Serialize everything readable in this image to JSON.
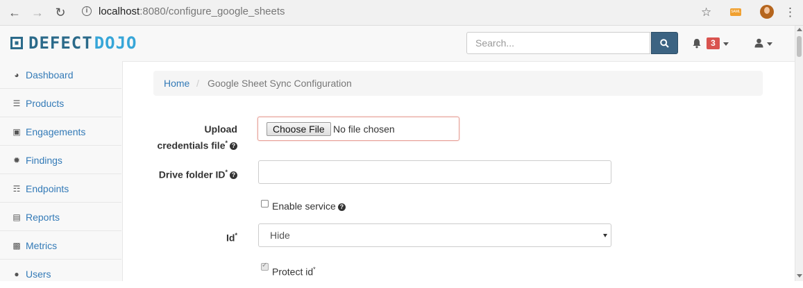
{
  "browser": {
    "host": "localhost",
    "path": ":8080/configure_google_sheets"
  },
  "header": {
    "logo_part1": "DEFECT",
    "logo_part2": "DOJO",
    "search_placeholder": "Search...",
    "notification_count": "3"
  },
  "sidebar": {
    "items": [
      {
        "label": "Dashboard",
        "icon": "dashboard-icon"
      },
      {
        "label": "Products",
        "icon": "list-icon"
      },
      {
        "label": "Engagements",
        "icon": "inbox-icon"
      },
      {
        "label": "Findings",
        "icon": "bug-icon"
      },
      {
        "label": "Endpoints",
        "icon": "sitemap-icon"
      },
      {
        "label": "Reports",
        "icon": "file-icon"
      },
      {
        "label": "Metrics",
        "icon": "bar-chart-icon"
      },
      {
        "label": "Users",
        "icon": "user-icon"
      }
    ]
  },
  "breadcrumb": {
    "home": "Home",
    "separator": "/",
    "current": "Google Sheet Sync Configuration"
  },
  "form": {
    "upload_label_line1": "Upload",
    "upload_label_line2": "credentials file",
    "choose_file_button": "Choose File",
    "no_file_text": "No file chosen",
    "drive_folder_label": "Drive folder ID",
    "drive_folder_value": "",
    "enable_service_label": "Enable service",
    "enable_service_checked": false,
    "id_label": "Id",
    "id_select_value": "Hide",
    "protect_id_label": "Protect id",
    "protect_id_checked": true,
    "required_marker": "*"
  },
  "colors": {
    "brand_dark": "#2b6a8a",
    "brand_light": "#37a6d8",
    "search_button": "#3c6382",
    "badge": "#d9534f",
    "link": "#337ab7"
  }
}
